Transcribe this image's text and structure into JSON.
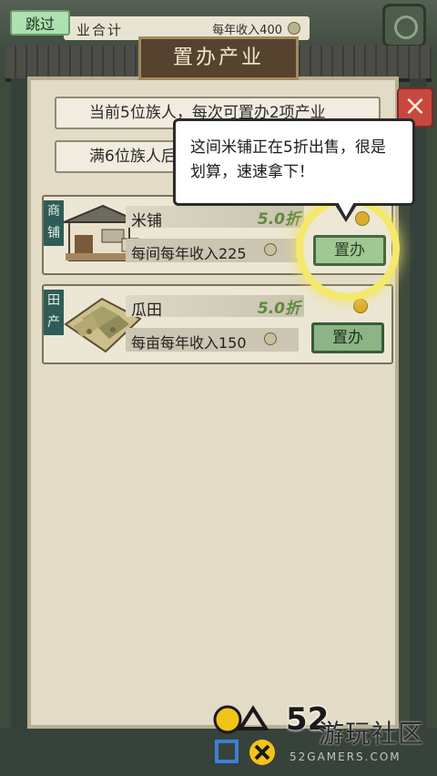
{
  "top": {
    "skip_label": "跳过",
    "summary_left": "业合计",
    "summary_right": "每年收入400"
  },
  "dialog": {
    "title": "置办产业",
    "close_label": "×",
    "info_lines": [
      "当前5位族人，每次可置办2项产业",
      "满6位族人后"
    ]
  },
  "tooltip": {
    "text": "这间米铺正在5折出售，很是划算，速速拿下！"
  },
  "properties": [
    {
      "category": "商铺",
      "name": "米铺",
      "discount": "5.0折",
      "income": "每间每年收入225",
      "buy_label": "置办"
    },
    {
      "category": "田产",
      "name": "瓜田",
      "discount": "5.0折",
      "income": "每亩每年收入150",
      "buy_label": "置办"
    }
  ],
  "watermark": {
    "number": "52",
    "text": "游玩社区",
    "url": "52GAMERS.COM"
  },
  "colors": {
    "accent_green": "#97c48f",
    "discount_green": "#5f8b3b",
    "close_red": "#c9483e",
    "highlight_yellow": "#f4e96b"
  }
}
